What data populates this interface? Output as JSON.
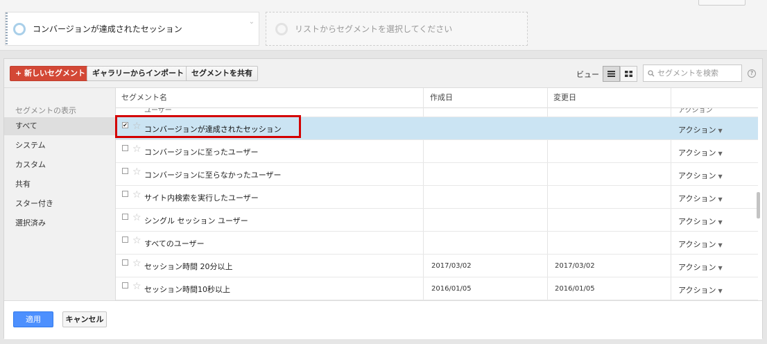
{
  "segment_bar": {
    "active_segment": "コンバージョンが達成されたセッション",
    "empty_slot": "リストからセグメントを選択してください"
  },
  "toolbar": {
    "new_segment": "+ 新しいセグメント",
    "import_gallery": "ギャラリーからインポート",
    "share_segment": "セグメントを共有",
    "view_label": "ビュー",
    "search_placeholder": "セグメントを検索",
    "help": "?"
  },
  "sidebar": {
    "heading": "セグメントの表示",
    "items": [
      {
        "label": "すべて",
        "selected": true
      },
      {
        "label": "システム"
      },
      {
        "label": "カスタム"
      },
      {
        "label": "共有"
      },
      {
        "label": "スター付き"
      },
      {
        "label": "選択済み"
      }
    ]
  },
  "table": {
    "headers": {
      "name": "セグメント名",
      "created": "作成日",
      "modified": "変更日"
    },
    "partial_top_row": {
      "name": "ユーザー",
      "created": "- - -",
      "modified": "- - -",
      "action": "アクション"
    },
    "rows": [
      {
        "name": "コンバージョンが達成されたセッション",
        "created": "",
        "modified": "",
        "action": "アクション",
        "checked": true
      },
      {
        "name": "コンバージョンに至ったユーザー",
        "created": "",
        "modified": "",
        "action": "アクション"
      },
      {
        "name": "コンバージョンに至らなかったユーザー",
        "created": "",
        "modified": "",
        "action": "アクション"
      },
      {
        "name": "サイト内検索を実行したユーザー",
        "created": "",
        "modified": "",
        "action": "アクション"
      },
      {
        "name": "シングル セッション ユーザー",
        "created": "",
        "modified": "",
        "action": "アクション"
      },
      {
        "name": "すべてのユーザー",
        "created": "",
        "modified": "",
        "action": "アクション"
      },
      {
        "name": "セッション時間 20分以上",
        "created": "2017/03/02",
        "modified": "2017/03/02",
        "action": "アクション"
      },
      {
        "name": "セッション時間10秒以上",
        "created": "2016/01/05",
        "modified": "2016/01/05",
        "action": "アクション"
      }
    ]
  },
  "footer": {
    "apply": "適用",
    "cancel": "キャンセル"
  },
  "colors": {
    "new_button": "#d34836",
    "apply_button": "#4d90fe",
    "selected_row": "#cbe4f3",
    "highlight_box": "#d40000"
  }
}
